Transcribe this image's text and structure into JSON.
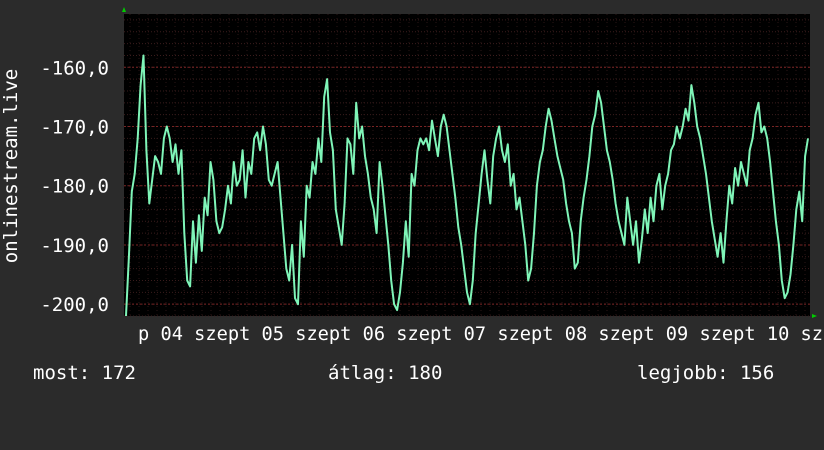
{
  "chart_data": {
    "type": "line",
    "ylabel": "onlinestream.live",
    "ylim": [
      -202,
      -151
    ],
    "yticks": [
      {
        "value": -160,
        "label": "-160,0"
      },
      {
        "value": -170,
        "label": "-170,0"
      },
      {
        "value": -180,
        "label": "-180,0"
      },
      {
        "value": -190,
        "label": "-190,0"
      },
      {
        "value": -200,
        "label": "-200,0"
      }
    ],
    "x_tick_labels": [
      "p 04 szept 05 szept 06 szept 07 szept 08 szept 09 szept 10 sz"
    ],
    "grid": true,
    "line_color": "#7ff5b8",
    "series": [
      {
        "values": [
          -202,
          -192,
          -181,
          -178,
          -172,
          -163,
          -158,
          -174,
          -183,
          -179,
          -175,
          -176,
          -178,
          -172,
          -170,
          -172,
          -176,
          -173,
          -178,
          -174,
          -188,
          -196,
          -197,
          -186,
          -193,
          -185,
          -191,
          -182,
          -185,
          -176,
          -179,
          -186,
          -188,
          -187,
          -184,
          -180,
          -183,
          -176,
          -180,
          -179,
          -174,
          -182,
          -176,
          -178,
          -172,
          -171,
          -174,
          -170,
          -173,
          -179,
          -180,
          -178,
          -176,
          -182,
          -188,
          -194,
          -196,
          -190,
          -199,
          -200,
          -186,
          -192,
          -180,
          -182,
          -176,
          -178,
          -172,
          -176,
          -165,
          -162,
          -171,
          -174,
          -184,
          -187,
          -190,
          -183,
          -172,
          -173,
          -178,
          -166,
          -172,
          -170,
          -175,
          -178,
          -182,
          -184,
          -188,
          -176,
          -180,
          -185,
          -190,
          -196,
          -200,
          -201,
          -198,
          -193,
          -186,
          -192,
          -178,
          -180,
          -174,
          -172,
          -173,
          -172,
          -174,
          -169,
          -172,
          -175,
          -170,
          -168,
          -170,
          -174,
          -178,
          -182,
          -187,
          -190,
          -194,
          -198,
          -200,
          -196,
          -188,
          -183,
          -178,
          -174,
          -179,
          -183,
          -175,
          -172,
          -170,
          -174,
          -176,
          -173,
          -180,
          -178,
          -184,
          -182,
          -186,
          -190,
          -196,
          -194,
          -188,
          -180,
          -176,
          -174,
          -170,
          -167,
          -169,
          -172,
          -175,
          -177,
          -179,
          -183,
          -186,
          -188,
          -194,
          -193,
          -186,
          -182,
          -179,
          -175,
          -170,
          -168,
          -164,
          -166,
          -170,
          -174,
          -176,
          -179,
          -183,
          -186,
          -188,
          -190,
          -182,
          -186,
          -190,
          -186,
          -193,
          -189,
          -184,
          -188,
          -182,
          -186,
          -180,
          -178,
          -184,
          -180,
          -178,
          -174,
          -173,
          -170,
          -172,
          -170,
          -167,
          -169,
          -163,
          -166,
          -170,
          -172,
          -175,
          -178,
          -182,
          -186,
          -189,
          -192,
          -188,
          -193,
          -186,
          -180,
          -183,
          -177,
          -180,
          -176,
          -178,
          -180,
          -174,
          -172,
          -168,
          -166,
          -171,
          -170,
          -172,
          -176,
          -181,
          -186,
          -190,
          -196,
          -199,
          -198,
          -195,
          -190,
          -184,
          -181,
          -186,
          -175,
          -172
        ]
      }
    ]
  },
  "stats": {
    "current": "most: 172",
    "average": "átlag: 180",
    "best": "legjobb: 156"
  }
}
